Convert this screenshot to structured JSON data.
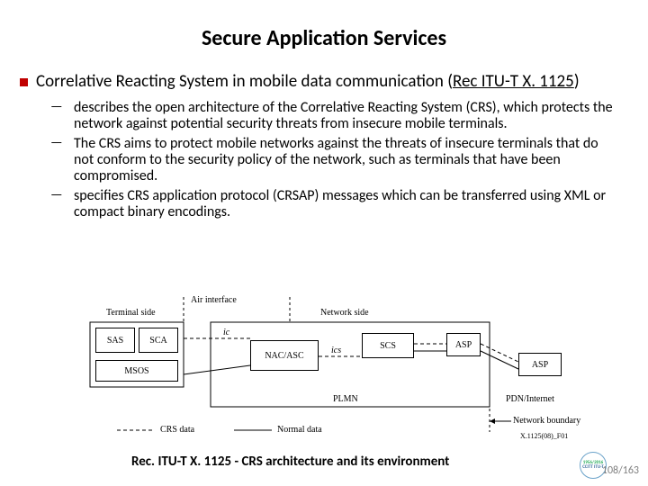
{
  "title": "Secure Application Services",
  "bullet": {
    "text_a": "Correlative Reacting System in mobile data communication (",
    "ref": "Rec ITU-T X. 1125",
    "text_b": ")"
  },
  "subs": [
    "describes the open architecture of the Correlative Reacting System (CRS), which protects the network against potential security threats from insecure mobile terminals.",
    "The CRS aims to protect mobile networks against the threats of insecure terminals that do not conform to the security policy of the network, such as terminals that have been compromised.",
    "specifies CRS application protocol (CRSAP) messages which can be transferred using XML or compact binary encodings."
  ],
  "caption": "Rec. ITU-T X. 1125 - CRS architecture and its environment",
  "page": "108/163",
  "logo": {
    "years": "1956/2016",
    "org": "CCITT ITU-T"
  },
  "diagram": {
    "top": {
      "air": "Air interface",
      "term": "Terminal side",
      "net": "Network side"
    },
    "boxes": {
      "sas": "SAS",
      "sca": "SCA",
      "msos": "MSOS",
      "nac": "NAC/ASC",
      "scs": "SCS",
      "asp1": "ASP",
      "asp2": "ASP"
    },
    "if": {
      "ic": "ic",
      "ics": "ics"
    },
    "areas": {
      "plmn": "PLMN",
      "pdn": "PDN/Internet"
    },
    "boundary": "Network boundary",
    "legend": {
      "crs": "CRS data",
      "normal": "Normal data"
    },
    "figref": "X.1125(08)_F01"
  }
}
